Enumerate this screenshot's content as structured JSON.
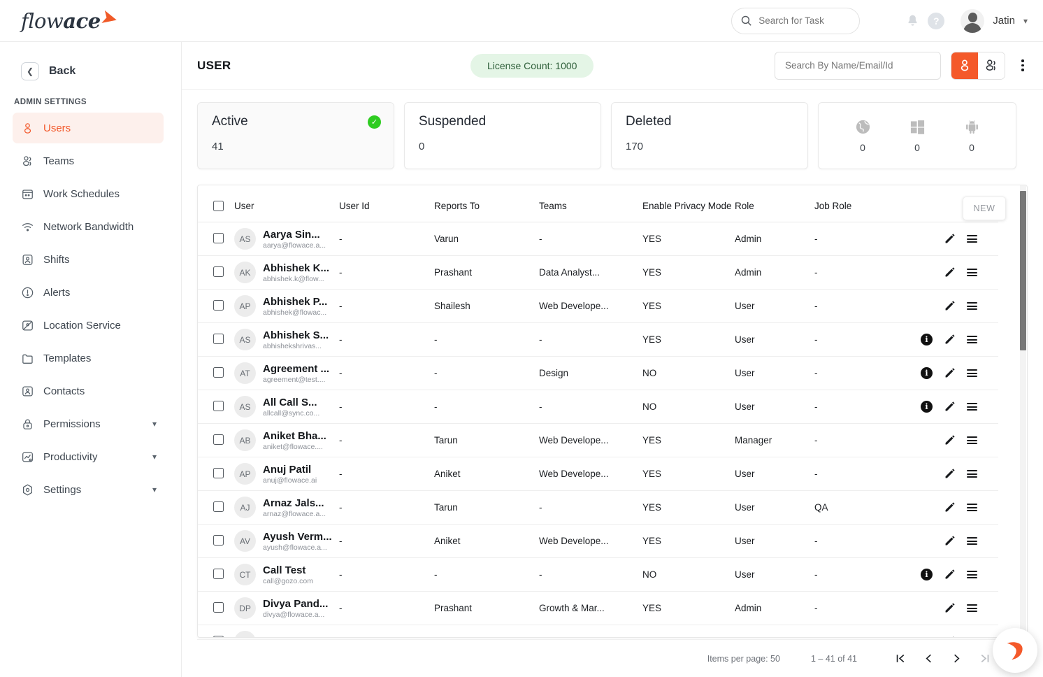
{
  "brand": {
    "logo_light": "flow",
    "logo_bold": "ace"
  },
  "topbar": {
    "task_search_placeholder": "Search for Task",
    "user_name": "Jatin",
    "help_label": "?"
  },
  "sidebar": {
    "back_label": "Back",
    "section_title": "ADMIN SETTINGS",
    "items": [
      {
        "label": "Users",
        "icon": "user-icon",
        "active": true,
        "expandable": false
      },
      {
        "label": "Teams",
        "icon": "users-icon",
        "active": false,
        "expandable": false
      },
      {
        "label": "Work Schedules",
        "icon": "calendar-icon",
        "active": false,
        "expandable": false
      },
      {
        "label": "Network Bandwidth",
        "icon": "wifi-icon",
        "active": false,
        "expandable": false
      },
      {
        "label": "Shifts",
        "icon": "badge-icon",
        "active": false,
        "expandable": false
      },
      {
        "label": "Alerts",
        "icon": "alert-icon",
        "active": false,
        "expandable": false
      },
      {
        "label": "Location Service",
        "icon": "location-icon",
        "active": false,
        "expandable": false
      },
      {
        "label": "Templates",
        "icon": "folder-icon",
        "active": false,
        "expandable": false
      },
      {
        "label": "Contacts",
        "icon": "contact-icon",
        "active": false,
        "expandable": false
      },
      {
        "label": "Permissions",
        "icon": "lock-icon",
        "active": false,
        "expandable": true
      },
      {
        "label": "Productivity",
        "icon": "productivity-icon",
        "active": false,
        "expandable": true
      },
      {
        "label": "Settings",
        "icon": "settings-icon",
        "active": false,
        "expandable": true
      }
    ]
  },
  "page": {
    "title": "USER",
    "license_pill": "License Count: 1000",
    "search_placeholder": "Search By Name/Email/Id",
    "new_button": "NEW"
  },
  "cards": {
    "active": {
      "title": "Active",
      "value": "41",
      "badge": "check-icon"
    },
    "suspended": {
      "title": "Suspended",
      "value": "0"
    },
    "deleted": {
      "title": "Deleted",
      "value": "170"
    },
    "platforms": [
      {
        "icon": "globe-icon",
        "value": "0"
      },
      {
        "icon": "windows-icon",
        "value": "0"
      },
      {
        "icon": "android-icon",
        "value": "0"
      }
    ]
  },
  "table": {
    "columns": [
      "User",
      "User Id",
      "Reports To",
      "Teams",
      "Enable Privacy Mode",
      "Role",
      "Job Role"
    ],
    "rows": [
      {
        "initials": "AS",
        "name": "Aarya Sin...",
        "email": "aarya@flowace.a...",
        "user_id": "-",
        "reports_to": "Varun",
        "teams": "-",
        "privacy": "YES",
        "role": "Admin",
        "job_role": "-",
        "info": false
      },
      {
        "initials": "AK",
        "name": "Abhishek K...",
        "email": "abhishek.k@flow...",
        "user_id": "-",
        "reports_to": "Prashant",
        "teams": "Data Analyst...",
        "privacy": "YES",
        "role": "Admin",
        "job_role": "-",
        "info": false
      },
      {
        "initials": "AP",
        "name": "Abhishek P...",
        "email": "abhishek@flowac...",
        "user_id": "-",
        "reports_to": "Shailesh",
        "teams": "Web Develope...",
        "privacy": "YES",
        "role": "User",
        "job_role": "-",
        "info": false
      },
      {
        "initials": "AS",
        "name": "Abhishek S...",
        "email": "abhishekshrivas...",
        "user_id": "-",
        "reports_to": "-",
        "teams": "-",
        "privacy": "YES",
        "role": "User",
        "job_role": "-",
        "info": true
      },
      {
        "initials": "AT",
        "name": "Agreement ...",
        "email": "agreement@test....",
        "user_id": "-",
        "reports_to": "-",
        "teams": "Design",
        "privacy": "NO",
        "role": "User",
        "job_role": "-",
        "info": true
      },
      {
        "initials": "AS",
        "name": "All Call S...",
        "email": "allcall@sync.co...",
        "user_id": "-",
        "reports_to": "-",
        "teams": "-",
        "privacy": "NO",
        "role": "User",
        "job_role": "-",
        "info": true
      },
      {
        "initials": "AB",
        "name": "Aniket Bha...",
        "email": "aniket@flowace....",
        "user_id": "-",
        "reports_to": "Tarun",
        "teams": "Web Develope...",
        "privacy": "YES",
        "role": "Manager",
        "job_role": "-",
        "info": false
      },
      {
        "initials": "AP",
        "name": "Anuj Patil",
        "email": "anuj@flowace.ai",
        "user_id": "-",
        "reports_to": "Aniket",
        "teams": "Web Develope...",
        "privacy": "YES",
        "role": "User",
        "job_role": "-",
        "info": false
      },
      {
        "initials": "AJ",
        "name": "Arnaz Jals...",
        "email": "arnaz@flowace.a...",
        "user_id": "-",
        "reports_to": "Tarun",
        "teams": "-",
        "privacy": "YES",
        "role": "User",
        "job_role": "QA",
        "info": false
      },
      {
        "initials": "AV",
        "name": "Ayush Verm...",
        "email": "ayush@flowace.a...",
        "user_id": "-",
        "reports_to": "Aniket",
        "teams": "Web Develope...",
        "privacy": "YES",
        "role": "User",
        "job_role": "-",
        "info": false
      },
      {
        "initials": "CT",
        "name": "Call Test",
        "email": "call@gozo.com",
        "user_id": "-",
        "reports_to": "-",
        "teams": "-",
        "privacy": "NO",
        "role": "User",
        "job_role": "-",
        "info": true
      },
      {
        "initials": "DP",
        "name": "Divya Pand...",
        "email": "divya@flowace.a...",
        "user_id": "-",
        "reports_to": "Prashant",
        "teams": "Growth & Mar...",
        "privacy": "YES",
        "role": "Admin",
        "job_role": "-",
        "info": false
      },
      {
        "initials": "GD",
        "name": "Gale Dsyly",
        "email": "",
        "user_id": "",
        "reports_to": "",
        "teams": "",
        "privacy": "",
        "role": "",
        "job_role": "",
        "info": false
      }
    ]
  },
  "paginator": {
    "items_per_page_label": "Items per page: 50",
    "range_label": "1 – 41 of 41"
  },
  "colors": {
    "accent": "#f4592a",
    "pill_bg": "#e4f5e6",
    "active_nav_bg": "#fdf0ec",
    "success": "#2ecc21"
  }
}
